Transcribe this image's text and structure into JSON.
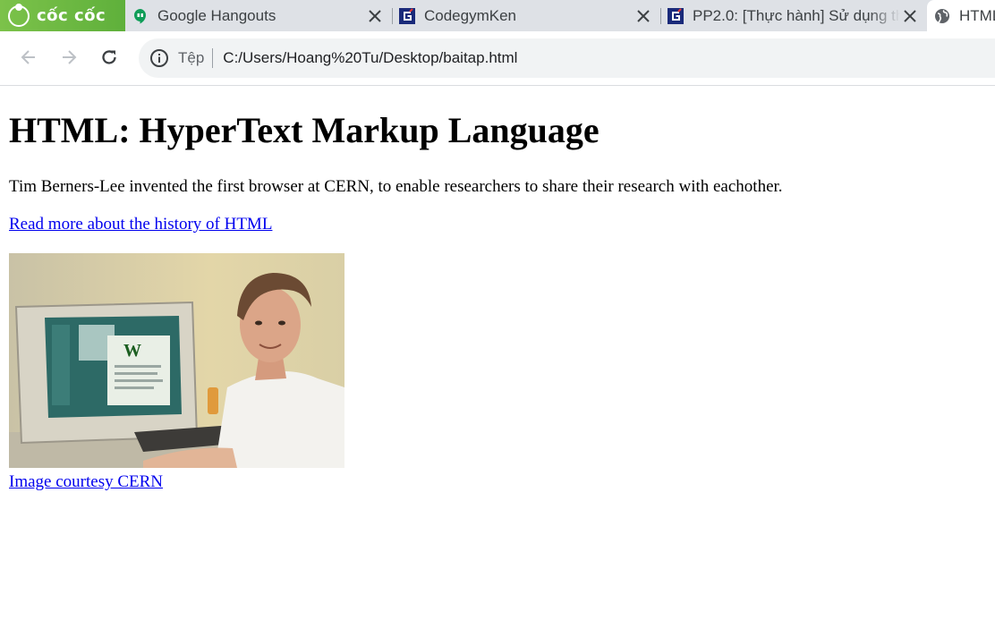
{
  "browser": {
    "brand_name": "cốc cốc",
    "tabs": [
      {
        "title": "Google Hangouts",
        "favicon": "hangouts-icon",
        "active": false
      },
      {
        "title": "CodegymKen",
        "favicon": "codegym-icon",
        "active": false
      },
      {
        "title": "PP2.0: [Thực hành] Sử dụng th",
        "favicon": "codegym-icon",
        "active": false
      },
      {
        "title": "HTML",
        "favicon": "globe-icon",
        "active": true
      }
    ],
    "address_bar": {
      "scheme_label": "Tệp",
      "url": "C:/Users/Hoang%20Tu/Desktop/baitap.html"
    },
    "colors": {
      "tabstrip": "#dee1e6",
      "brand_green": "#6cbb44",
      "omnibox": "#f1f3f4",
      "link": "#0000ee"
    }
  },
  "page": {
    "heading": "HTML: HyperText Markup Language",
    "intro": "Tim Berners-Lee invented the first browser at CERN, to enable researchers to share their research with eachother.",
    "history_link": "Read more about the history of HTML",
    "image_caption_link": "Image courtesy CERN"
  }
}
